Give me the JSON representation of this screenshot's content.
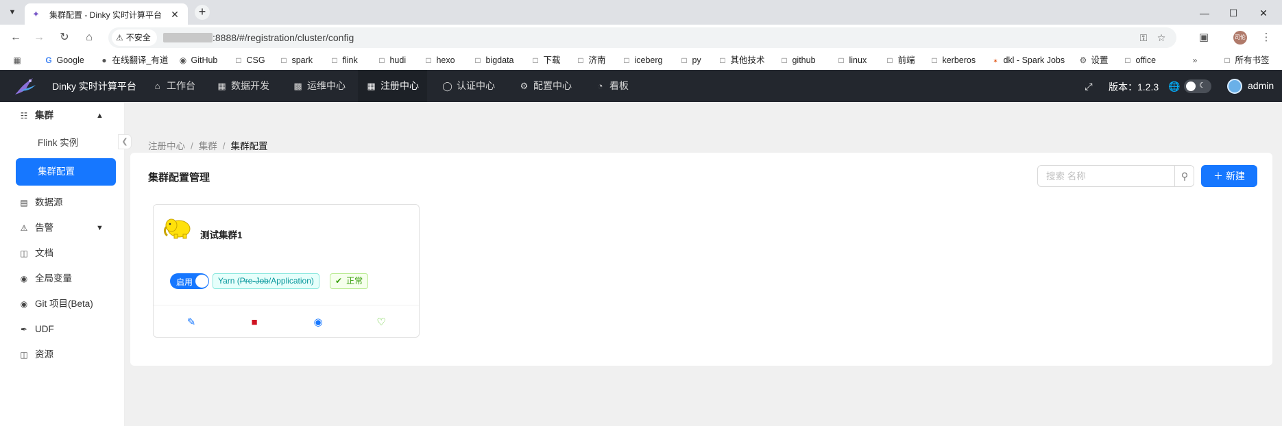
{
  "browser": {
    "tab_title": "集群配置 - Dinky 实时计算平台",
    "security_label": "不安全",
    "url": ":8888/#/registration/cluster/config",
    "bookmarks": [
      "Google",
      "在线翻译_有道",
      "GitHub",
      "CSG",
      "spark",
      "flink",
      "hudi",
      "hexo",
      "bigdata",
      "下载",
      "济南",
      "iceberg",
      "py",
      "其他技术",
      "github",
      "linux",
      "前端",
      "kerberos",
      "dkl - Spark Jobs",
      "设置",
      "office"
    ],
    "all_bookmarks": "所有书签",
    "profile_label": "司伦"
  },
  "header": {
    "app_title": "Dinky 实时计算平台",
    "nav": [
      "工作台",
      "数据开发",
      "运维中心",
      "注册中心",
      "认证中心",
      "配置中心",
      "看板"
    ],
    "active_nav": "注册中心",
    "version": "版本：1.2.3",
    "username": "admin"
  },
  "sidebar": {
    "group": "集群",
    "children": [
      "Flink 实例",
      "集群配置"
    ],
    "active": "集群配置",
    "items": [
      "数据源",
      "告警",
      "文档",
      "全局变量",
      "Git 项目(Beta)",
      "UDF",
      "资源"
    ]
  },
  "breadcrumb": [
    "注册中心",
    "集群",
    "集群配置"
  ],
  "page": {
    "title": "集群配置管理",
    "search_placeholder": "搜索 名称",
    "new_button": "新建"
  },
  "cards": [
    {
      "name": "测试集群1",
      "enabled_label": "启用",
      "enabled": true,
      "type_prefix": "Yarn (",
      "type_struck": "Pre-Job",
      "type_suffix": "/Application)",
      "status": "正常"
    }
  ],
  "colors": {
    "primary": "#1677ff",
    "header_bg": "#23272e",
    "type_tag": "#08979c",
    "status_tag": "#389e0d",
    "delete_icon": "#cf1322"
  }
}
